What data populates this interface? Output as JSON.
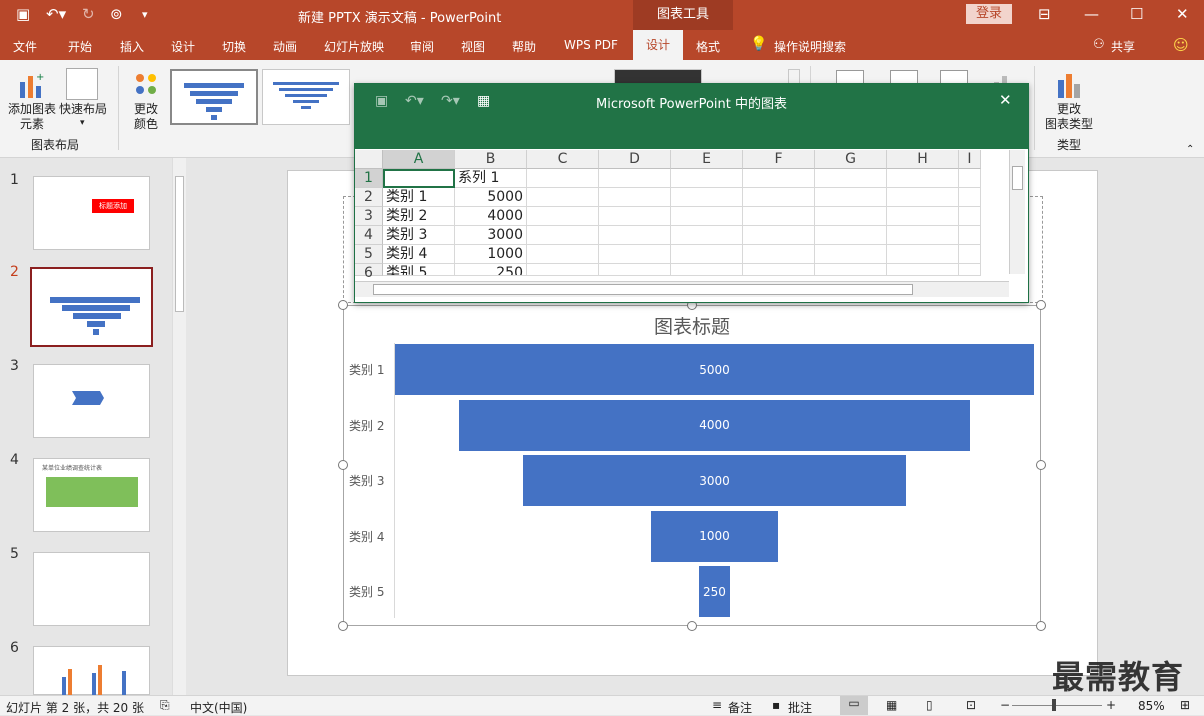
{
  "titlebar": {
    "doc_title": "新建 PPTX 演示文稿  -  PowerPoint",
    "context_tools": "图表工具",
    "login": "登录"
  },
  "tabs": [
    "文件",
    "开始",
    "插入",
    "设计",
    "切换",
    "动画",
    "幻灯片放映",
    "审阅",
    "视图",
    "帮助",
    "WPS PDF"
  ],
  "ctx_tabs": {
    "design": "设计",
    "format": "格式"
  },
  "search_hint": "操作说明搜索",
  "share": "共享",
  "ribbon": {
    "add_element": "添加图表\n元素",
    "add_element_line1": "添加图表",
    "add_element_line2": "元素",
    "quick_layout": "快速布局",
    "group_layout": "图表布局",
    "change_color_line1": "更改",
    "change_color_line2": "颜色",
    "change_type_line1": "更改",
    "change_type_line2": "图表类型",
    "group_type": "类型"
  },
  "slides": [
    "1",
    "2",
    "3",
    "4",
    "5",
    "6"
  ],
  "slide_thumbs": {
    "s1_title": "标题添加",
    "s4_title": "某单位业绩调查统计表"
  },
  "sheet": {
    "title": "Microsoft PowerPoint 中的图表",
    "columns": [
      "A",
      "B",
      "C",
      "D",
      "E",
      "F",
      "G",
      "H",
      "I"
    ],
    "rows": [
      {
        "n": "1",
        "a": "",
        "b": "系列 1"
      },
      {
        "n": "2",
        "a": "类别 1",
        "b": "5000"
      },
      {
        "n": "3",
        "a": "类别 2",
        "b": "4000"
      },
      {
        "n": "4",
        "a": "类别 3",
        "b": "3000"
      },
      {
        "n": "5",
        "a": "类别 4",
        "b": "1000"
      },
      {
        "n": "6",
        "a": "类别 5",
        "b": "250"
      }
    ]
  },
  "chart_data": {
    "type": "bar",
    "subtype": "funnel",
    "title": "图表标题",
    "categories": [
      "类别 1",
      "类别 2",
      "类别 3",
      "类别 4",
      "类别 5"
    ],
    "values": [
      5000,
      4000,
      3000,
      1000,
      250
    ],
    "labels": [
      "5000",
      "4000",
      "3000",
      "1000",
      "250"
    ],
    "color": "#4472c4"
  },
  "status": {
    "slide_info": "幻灯片 第 2 张，共 20 张",
    "language": "中文(中国)",
    "notes": "备注",
    "comments": "批注",
    "zoom": "85%"
  },
  "watermark": "最需教育"
}
